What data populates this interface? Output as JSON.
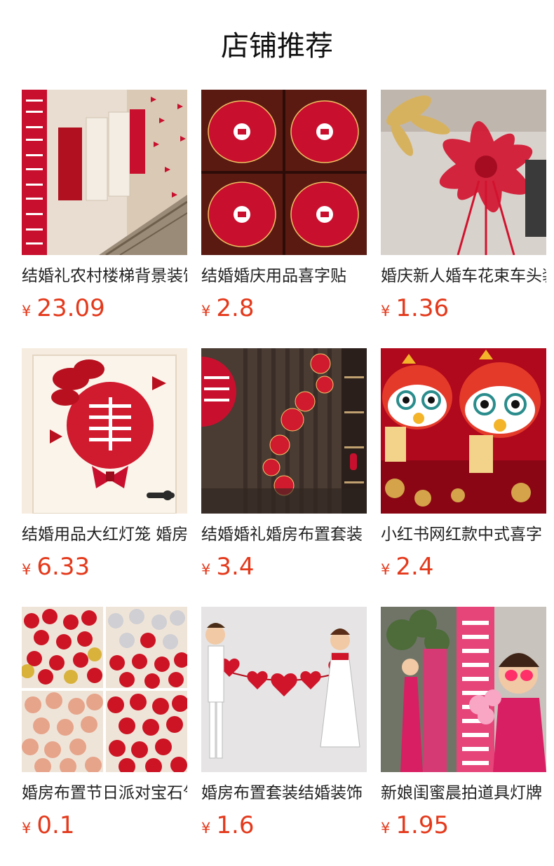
{
  "header": {
    "title": "店铺推荐"
  },
  "colors": {
    "price": "#e4391b",
    "accent_red": "#c8102e"
  },
  "products": [
    {
      "name": "结婚礼农村楼梯背景装饰",
      "currency": "¥",
      "price": "23.09",
      "image": "staircase-wedding-decor-image"
    },
    {
      "name": "结婚婚庆用品喜字贴",
      "currency": "¥",
      "price": "2.8",
      "image": "double-happiness-stickers-image"
    },
    {
      "name": "婚庆新人婚车花束车头装饰",
      "currency": "¥",
      "price": "1.36",
      "image": "red-ribbon-bow-image"
    },
    {
      "name": "结婚用品大红灯笼 婚房布置",
      "currency": "¥",
      "price": "6.33",
      "image": "door-happiness-bow-image"
    },
    {
      "name": "结婚婚礼婚房布置套装",
      "currency": "¥",
      "price": "3.4",
      "image": "wall-fan-decor-image"
    },
    {
      "name": "小红书网红款中式喜字",
      "currency": "¥",
      "price": "2.4",
      "image": "lion-dance-dolls-image"
    },
    {
      "name": "婚房布置节日派对宝石气球",
      "currency": "¥",
      "price": "0.1",
      "image": "balloons-image"
    },
    {
      "name": "婚房布置套装结婚装饰",
      "currency": "¥",
      "price": "1.6",
      "image": "cartoon-couple-hearts-image"
    },
    {
      "name": "新娘闺蜜晨拍道具灯牌",
      "currency": "¥",
      "price": "1.95",
      "image": "bridesmaid-props-image"
    }
  ]
}
